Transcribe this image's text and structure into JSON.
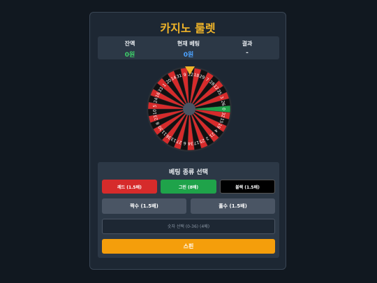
{
  "title": "카지노 룰렛",
  "stats": {
    "balance_label": "잔액",
    "balance_value": "0원",
    "bet_label": "현재 베팅",
    "bet_value": "0원",
    "result_label": "결과",
    "result_value": "-"
  },
  "wheel": {
    "numbers": [
      0,
      32,
      15,
      19,
      4,
      21,
      2,
      25,
      17,
      34,
      6,
      27,
      13,
      36,
      11,
      30,
      8,
      23,
      10,
      5,
      24,
      16,
      33,
      1,
      20,
      14,
      31,
      9,
      22,
      18,
      29,
      7,
      28,
      12,
      35,
      3,
      26
    ],
    "colors": {
      "red": "#d62b2b",
      "black": "#111111",
      "green": "#1fa34a",
      "hub": "#4a5564",
      "rim": "#2a2f36"
    }
  },
  "panel": {
    "title": "베팅 종류 선택",
    "red_label": "레드 (1.5배)",
    "green_label": "그린 (8배)",
    "black_label": "블랙 (1.5배)",
    "even_label": "짝수 (1.5배)",
    "odd_label": "홀수 (1.5배)",
    "number_placeholder": "숫자 선택 (0-36) (4배)",
    "spin_label": "스핀"
  }
}
